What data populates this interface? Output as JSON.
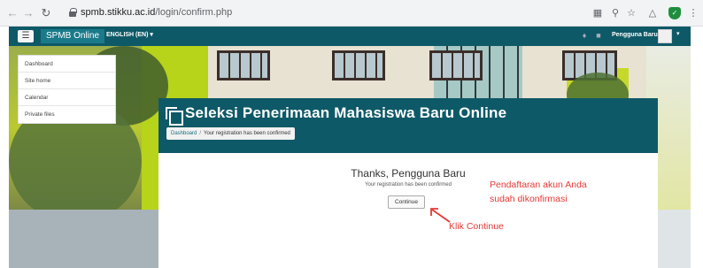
{
  "browser": {
    "url_host": "spmb.stikku.ac.id",
    "url_path": "/login/confirm.php"
  },
  "navbar": {
    "brand": "SPMB Online",
    "language": "ENGLISH (EN)",
    "username": "Pengguna Baru"
  },
  "sidebar": {
    "items": [
      {
        "label": "Dashboard"
      },
      {
        "label": "Site home"
      },
      {
        "label": "Calendar"
      },
      {
        "label": "Private files"
      }
    ]
  },
  "header": {
    "title": "Seleksi Penerimaan Mahasiswa Baru Online",
    "breadcrumb": {
      "home": "Dashboard",
      "current": "Your registration has been confirmed"
    }
  },
  "content": {
    "thanks": "Thanks, Pengguna Baru",
    "message": "Your registration has been confirmed",
    "continue_label": "Continue"
  },
  "annotations": {
    "confirmed_line1": "Pendaftaran akun Anda",
    "confirmed_line2": "sudah dikonfirmasi",
    "click_continue": "Klik Continue",
    "color": "#e53935"
  },
  "colors": {
    "navbar": "#0e5967",
    "brand_button": "#1a7a8a"
  }
}
